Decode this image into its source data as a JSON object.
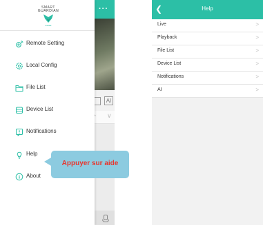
{
  "drawer": {
    "logo_text": "SMART\nGUARDIAN",
    "items": [
      {
        "label": "Remote Setting",
        "icon": "gear-icon"
      },
      {
        "label": "Local Config",
        "icon": "settings-cog-icon"
      },
      {
        "label": "File List",
        "icon": "folder-icon"
      },
      {
        "label": "Device List",
        "icon": "device-stack-icon"
      },
      {
        "label": "Notifications",
        "icon": "alert-icon"
      },
      {
        "label": "Help",
        "icon": "lightbulb-icon"
      },
      {
        "label": "About",
        "icon": "info-icon"
      }
    ]
  },
  "underlay": {
    "more_label": "···"
  },
  "callout": {
    "text": "Appuyer sur aide"
  },
  "help": {
    "title": "Help",
    "items": [
      {
        "label": "Live"
      },
      {
        "label": "Playback"
      },
      {
        "label": "File List"
      },
      {
        "label": "Device List"
      },
      {
        "label": "Notifications"
      },
      {
        "label": "AI"
      }
    ]
  },
  "colors": {
    "accent": "#2cbfa6",
    "callout_bg": "#8ccbe0",
    "callout_text": "#e8362d"
  }
}
